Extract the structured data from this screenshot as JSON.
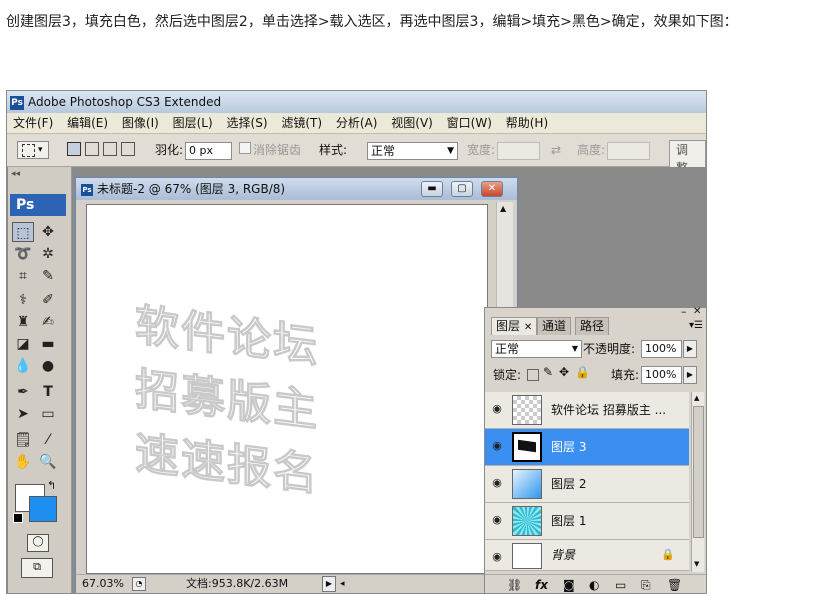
{
  "intro_text": "创建图层3，填充白色，然后选中图层2，单击选择>载入选区，再选中图层3，编辑>填充>黑色>确定，效果如下图：",
  "app": {
    "title": "Adobe Photoshop CS3 Extended",
    "logo": "Ps"
  },
  "menu": [
    "文件(F)",
    "编辑(E)",
    "图像(I)",
    "图层(L)",
    "选择(S)",
    "滤镜(T)",
    "分析(A)",
    "视图(V)",
    "窗口(W)",
    "帮助(H)"
  ],
  "options": {
    "feather_label": "羽化:",
    "feather_value": "0 px",
    "antialias_label": "消除锯齿",
    "style_label": "样式:",
    "style_value": "正常",
    "width_label": "宽度:",
    "height_label": "高度:",
    "refine_label": "调整边"
  },
  "toolbox": {
    "logo": "Ps"
  },
  "document": {
    "title": "未标题-2 @ 67% (图层 3, RGB/8)",
    "canvas_text_lines": [
      "软件论坛",
      "招募版主",
      "速速报名"
    ],
    "zoom": "67.03%",
    "doc_info": "文档:953.8K/2.63M"
  },
  "layers_panel": {
    "tabs": [
      "图层",
      "通道",
      "路径"
    ],
    "blend_mode": "正常",
    "opacity_label": "不透明度:",
    "opacity_value": "100%",
    "lock_label": "锁定:",
    "fill_label": "填充:",
    "fill_value": "100%",
    "layers": [
      {
        "name": "软件论坛 招募版主 ...",
        "selected": false,
        "thumb": "checker"
      },
      {
        "name": "图层 3",
        "selected": true,
        "thumb": "text-black"
      },
      {
        "name": "图层 2",
        "selected": false,
        "thumb": "blue-gradient"
      },
      {
        "name": "图层 1",
        "selected": false,
        "thumb": "cyan-rays"
      },
      {
        "name": "背景",
        "selected": false,
        "thumb": "white"
      }
    ]
  },
  "colors": {
    "accent": "#3b8ff0",
    "ps_blue": "#2d63b5",
    "workspace": "#8a8a8a"
  }
}
